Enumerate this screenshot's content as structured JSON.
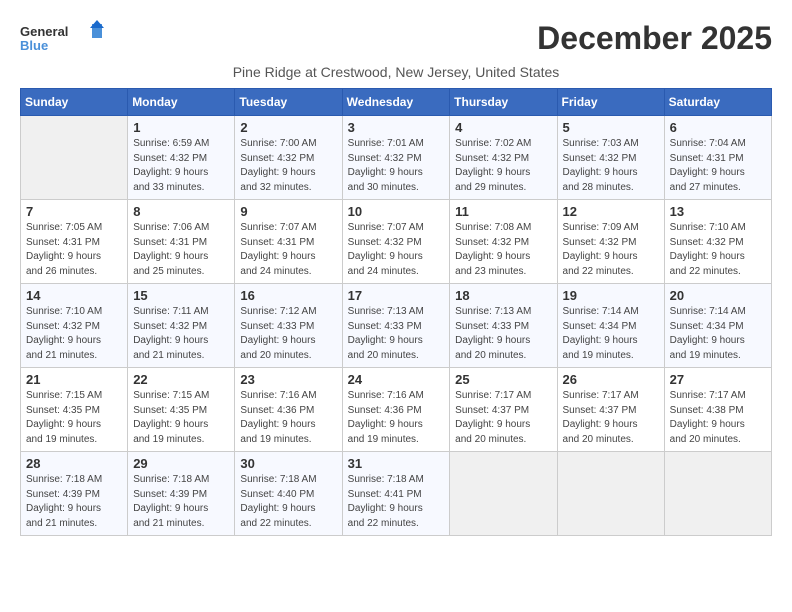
{
  "logo": {
    "line1": "General",
    "line2": "Blue"
  },
  "title": "December 2025",
  "subtitle": "Pine Ridge at Crestwood, New Jersey, United States",
  "days_of_week": [
    "Sunday",
    "Monday",
    "Tuesday",
    "Wednesday",
    "Thursday",
    "Friday",
    "Saturday"
  ],
  "weeks": [
    [
      {
        "day": "",
        "info": ""
      },
      {
        "day": "1",
        "info": "Sunrise: 6:59 AM\nSunset: 4:32 PM\nDaylight: 9 hours\nand 33 minutes."
      },
      {
        "day": "2",
        "info": "Sunrise: 7:00 AM\nSunset: 4:32 PM\nDaylight: 9 hours\nand 32 minutes."
      },
      {
        "day": "3",
        "info": "Sunrise: 7:01 AM\nSunset: 4:32 PM\nDaylight: 9 hours\nand 30 minutes."
      },
      {
        "day": "4",
        "info": "Sunrise: 7:02 AM\nSunset: 4:32 PM\nDaylight: 9 hours\nand 29 minutes."
      },
      {
        "day": "5",
        "info": "Sunrise: 7:03 AM\nSunset: 4:32 PM\nDaylight: 9 hours\nand 28 minutes."
      },
      {
        "day": "6",
        "info": "Sunrise: 7:04 AM\nSunset: 4:31 PM\nDaylight: 9 hours\nand 27 minutes."
      }
    ],
    [
      {
        "day": "7",
        "info": "Sunrise: 7:05 AM\nSunset: 4:31 PM\nDaylight: 9 hours\nand 26 minutes."
      },
      {
        "day": "8",
        "info": "Sunrise: 7:06 AM\nSunset: 4:31 PM\nDaylight: 9 hours\nand 25 minutes."
      },
      {
        "day": "9",
        "info": "Sunrise: 7:07 AM\nSunset: 4:31 PM\nDaylight: 9 hours\nand 24 minutes."
      },
      {
        "day": "10",
        "info": "Sunrise: 7:07 AM\nSunset: 4:32 PM\nDaylight: 9 hours\nand 24 minutes."
      },
      {
        "day": "11",
        "info": "Sunrise: 7:08 AM\nSunset: 4:32 PM\nDaylight: 9 hours\nand 23 minutes."
      },
      {
        "day": "12",
        "info": "Sunrise: 7:09 AM\nSunset: 4:32 PM\nDaylight: 9 hours\nand 22 minutes."
      },
      {
        "day": "13",
        "info": "Sunrise: 7:10 AM\nSunset: 4:32 PM\nDaylight: 9 hours\nand 22 minutes."
      }
    ],
    [
      {
        "day": "14",
        "info": "Sunrise: 7:10 AM\nSunset: 4:32 PM\nDaylight: 9 hours\nand 21 minutes."
      },
      {
        "day": "15",
        "info": "Sunrise: 7:11 AM\nSunset: 4:32 PM\nDaylight: 9 hours\nand 21 minutes."
      },
      {
        "day": "16",
        "info": "Sunrise: 7:12 AM\nSunset: 4:33 PM\nDaylight: 9 hours\nand 20 minutes."
      },
      {
        "day": "17",
        "info": "Sunrise: 7:13 AM\nSunset: 4:33 PM\nDaylight: 9 hours\nand 20 minutes."
      },
      {
        "day": "18",
        "info": "Sunrise: 7:13 AM\nSunset: 4:33 PM\nDaylight: 9 hours\nand 20 minutes."
      },
      {
        "day": "19",
        "info": "Sunrise: 7:14 AM\nSunset: 4:34 PM\nDaylight: 9 hours\nand 19 minutes."
      },
      {
        "day": "20",
        "info": "Sunrise: 7:14 AM\nSunset: 4:34 PM\nDaylight: 9 hours\nand 19 minutes."
      }
    ],
    [
      {
        "day": "21",
        "info": "Sunrise: 7:15 AM\nSunset: 4:35 PM\nDaylight: 9 hours\nand 19 minutes."
      },
      {
        "day": "22",
        "info": "Sunrise: 7:15 AM\nSunset: 4:35 PM\nDaylight: 9 hours\nand 19 minutes."
      },
      {
        "day": "23",
        "info": "Sunrise: 7:16 AM\nSunset: 4:36 PM\nDaylight: 9 hours\nand 19 minutes."
      },
      {
        "day": "24",
        "info": "Sunrise: 7:16 AM\nSunset: 4:36 PM\nDaylight: 9 hours\nand 19 minutes."
      },
      {
        "day": "25",
        "info": "Sunrise: 7:17 AM\nSunset: 4:37 PM\nDaylight: 9 hours\nand 20 minutes."
      },
      {
        "day": "26",
        "info": "Sunrise: 7:17 AM\nSunset: 4:37 PM\nDaylight: 9 hours\nand 20 minutes."
      },
      {
        "day": "27",
        "info": "Sunrise: 7:17 AM\nSunset: 4:38 PM\nDaylight: 9 hours\nand 20 minutes."
      }
    ],
    [
      {
        "day": "28",
        "info": "Sunrise: 7:18 AM\nSunset: 4:39 PM\nDaylight: 9 hours\nand 21 minutes."
      },
      {
        "day": "29",
        "info": "Sunrise: 7:18 AM\nSunset: 4:39 PM\nDaylight: 9 hours\nand 21 minutes."
      },
      {
        "day": "30",
        "info": "Sunrise: 7:18 AM\nSunset: 4:40 PM\nDaylight: 9 hours\nand 22 minutes."
      },
      {
        "day": "31",
        "info": "Sunrise: 7:18 AM\nSunset: 4:41 PM\nDaylight: 9 hours\nand 22 minutes."
      },
      {
        "day": "",
        "info": ""
      },
      {
        "day": "",
        "info": ""
      },
      {
        "day": "",
        "info": ""
      }
    ]
  ]
}
